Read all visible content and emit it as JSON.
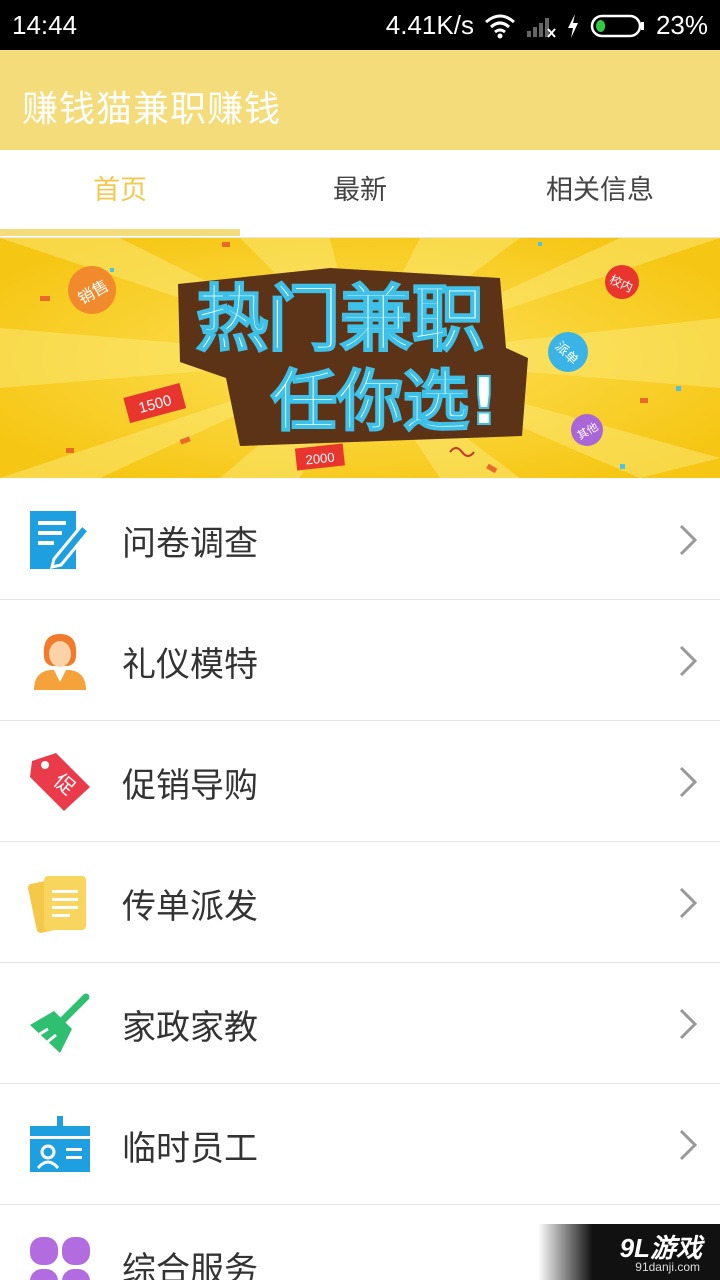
{
  "status_bar": {
    "time": "14:44",
    "network_speed": "4.41K/s",
    "battery_percent": "23%",
    "battery_level": 0.23,
    "icons": [
      "wifi-icon",
      "signal-icon",
      "charging-icon",
      "battery-icon"
    ]
  },
  "app_bar": {
    "title": "赚钱猫兼职赚钱",
    "color": "#f5dc7a"
  },
  "tabs": [
    {
      "label": "首页",
      "active": true
    },
    {
      "label": "最新",
      "active": false
    },
    {
      "label": "相关信息",
      "active": false
    }
  ],
  "banner": {
    "line1": "热门兼职",
    "line2": "任你选!",
    "badges": [
      "销售",
      "校内",
      "派单",
      "其他"
    ],
    "tickets": [
      "1500",
      "2000"
    ]
  },
  "categories": [
    {
      "label": "问卷调查",
      "icon": "survey-icon"
    },
    {
      "label": "礼仪模特",
      "icon": "model-icon"
    },
    {
      "label": "促销导购",
      "icon": "promo-tag-icon",
      "icon_text": "促"
    },
    {
      "label": "传单派发",
      "icon": "flyer-icon"
    },
    {
      "label": "家政家教",
      "icon": "broom-icon"
    },
    {
      "label": "临时员工",
      "icon": "id-card-icon"
    },
    {
      "label": "综合服务",
      "icon": "grid-icon"
    }
  ],
  "watermark": {
    "logo": "9L游戏",
    "url": "91danji.com"
  }
}
